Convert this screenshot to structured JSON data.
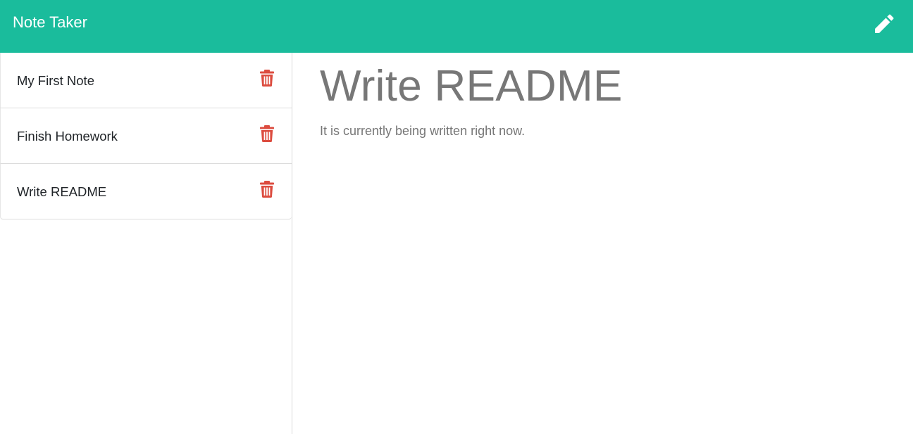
{
  "app": {
    "title": "Note Taker",
    "accent_color": "#1abc9c",
    "danger_color": "#dc4c3f"
  },
  "header": {
    "new_note_icon": "pencil-icon"
  },
  "sidebar": {
    "notes": [
      {
        "title": "My First Note",
        "delete_icon": "trash-icon"
      },
      {
        "title": "Finish Homework",
        "delete_icon": "trash-icon"
      },
      {
        "title": "Write README",
        "delete_icon": "trash-icon"
      }
    ]
  },
  "main": {
    "note_title": "Write README",
    "note_text": "It is currently being written right now."
  }
}
